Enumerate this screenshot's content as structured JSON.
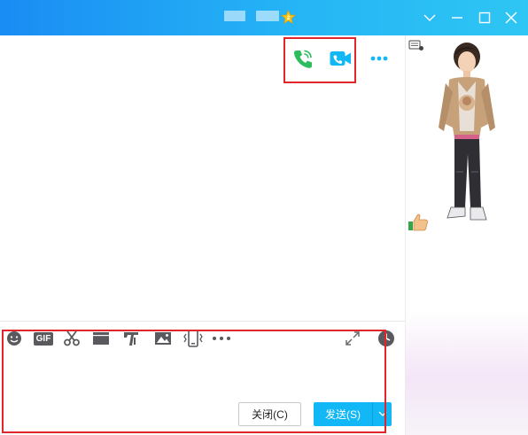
{
  "window": {
    "title_icons": [
      "name-placeholder-icon",
      "name-placeholder-icon",
      "vip-star-icon"
    ],
    "controls": [
      "chevron-down-icon",
      "minimize-icon",
      "maximize-icon",
      "close-icon"
    ],
    "accent_color": "#12b7f5",
    "titlebar_gradient": [
      "#1a8cf4",
      "#2ec6f4"
    ]
  },
  "chat_header": {
    "icons": [
      "voice-call-icon",
      "video-call-icon",
      "more-icon"
    ],
    "voice_color": "#2ebd5d",
    "video_color": "#12b7f5"
  },
  "toolbar": {
    "icons": [
      "emoji-icon",
      "gif-icon",
      "screenshot-scissors-icon",
      "window-shake-icon",
      "font-style-icon",
      "image-icon",
      "phone-shake-icon",
      "more-icon",
      "expand-icon",
      "history-icon"
    ],
    "gif_label": "GIF"
  },
  "actions": {
    "close_label": "关闭(C)",
    "send_label": "发送(S)"
  },
  "show_panel": {
    "icons": [
      "avatar-show-figure",
      "wardrobe-icon",
      "thumbs-up-icon"
    ]
  },
  "annotations": {
    "highlight_color": "#e0262a"
  }
}
